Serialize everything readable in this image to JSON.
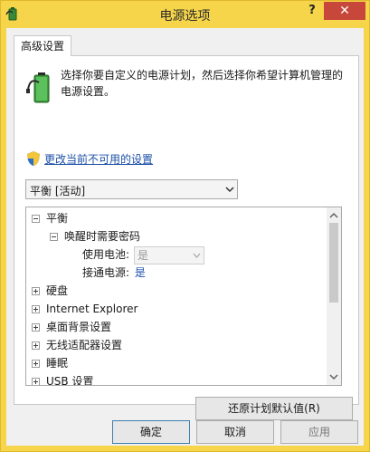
{
  "window": {
    "title": "电源选项",
    "help_label": "?",
    "close_label": "✕"
  },
  "tab": {
    "label": "高级设置"
  },
  "description": "选择你要自定义的电源计划，然后选择你希望计算机管理的电源设置。",
  "change_link": "更改当前不可用的设置",
  "plan_select": {
    "value": "平衡 [活动]"
  },
  "tree": {
    "items": [
      {
        "label": "平衡",
        "state": "expanded"
      },
      {
        "label": "唤醒时需要密码",
        "state": "expanded"
      },
      {
        "label": "使用电池:",
        "value": "是",
        "disabled": true
      },
      {
        "label": "接通电源:",
        "value": "是"
      },
      {
        "label": "硬盘",
        "state": "collapsed"
      },
      {
        "label": "Internet Explorer",
        "state": "collapsed"
      },
      {
        "label": "桌面背景设置",
        "state": "collapsed"
      },
      {
        "label": "无线适配器设置",
        "state": "collapsed"
      },
      {
        "label": "睡眠",
        "state": "collapsed"
      },
      {
        "label": "USB 设置",
        "state": "collapsed"
      }
    ]
  },
  "buttons": {
    "restore": "还原计划默认值(R)",
    "ok": "确定",
    "cancel": "取消",
    "apply": "应用"
  },
  "colors": {
    "titlebar": "#f6d54a",
    "close": "#c7483a",
    "link": "#1b4fa8"
  }
}
